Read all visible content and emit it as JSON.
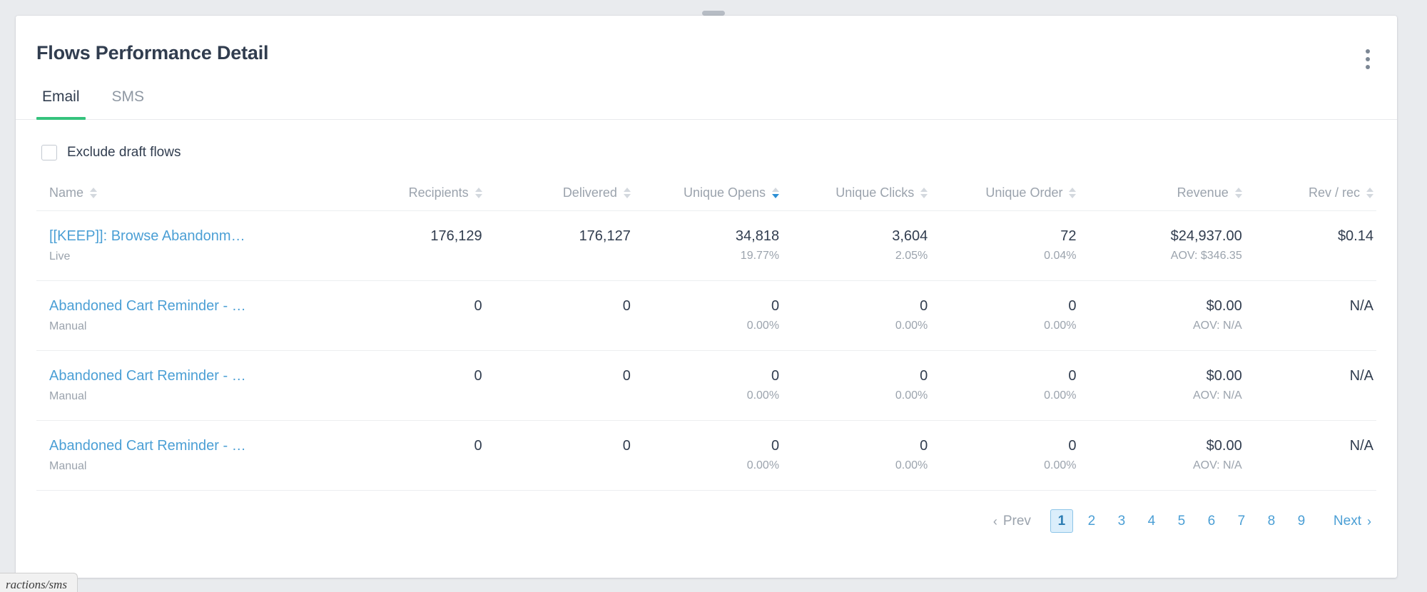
{
  "window": {
    "drag_handle": "drag-handle"
  },
  "header": {
    "title": "Flows Performance Detail",
    "menu_icon": "kebab-menu-icon"
  },
  "tabs": [
    {
      "label": "Email",
      "active": true
    },
    {
      "label": "SMS",
      "active": false
    }
  ],
  "filters": {
    "exclude_draft_flows": {
      "label": "Exclude draft flows",
      "checked": false
    }
  },
  "table": {
    "columns": [
      {
        "key": "name",
        "label": "Name",
        "align": "left",
        "sort": "none"
      },
      {
        "key": "recipients",
        "label": "Recipients",
        "align": "right",
        "sort": "none"
      },
      {
        "key": "delivered",
        "label": "Delivered",
        "align": "right",
        "sort": "none"
      },
      {
        "key": "unique_opens",
        "label": "Unique Opens",
        "align": "right",
        "sort": "desc"
      },
      {
        "key": "unique_clicks",
        "label": "Unique Clicks",
        "align": "right",
        "sort": "none"
      },
      {
        "key": "unique_order",
        "label": "Unique Order",
        "align": "right",
        "sort": "none"
      },
      {
        "key": "revenue",
        "label": "Revenue",
        "align": "right",
        "sort": "none"
      },
      {
        "key": "rev_rec",
        "label": "Rev / rec",
        "align": "right",
        "sort": "none"
      }
    ],
    "rows": [
      {
        "name": "[[KEEP]]: Browse Abandonm…",
        "status": "Live",
        "recipients": "176,129",
        "delivered": "176,127",
        "unique_opens": "34,818",
        "unique_opens_pct": "19.77%",
        "unique_clicks": "3,604",
        "unique_clicks_pct": "2.05%",
        "unique_order": "72",
        "unique_order_pct": "0.04%",
        "revenue": "$24,937.00",
        "revenue_aov": "AOV: $346.35",
        "rev_rec": "$0.14"
      },
      {
        "name": "Abandoned Cart Reminder - …",
        "status": "Manual",
        "recipients": "0",
        "delivered": "0",
        "unique_opens": "0",
        "unique_opens_pct": "0.00%",
        "unique_clicks": "0",
        "unique_clicks_pct": "0.00%",
        "unique_order": "0",
        "unique_order_pct": "0.00%",
        "revenue": "$0.00",
        "revenue_aov": "AOV: N/A",
        "rev_rec": "N/A"
      },
      {
        "name": "Abandoned Cart Reminder - …",
        "status": "Manual",
        "recipients": "0",
        "delivered": "0",
        "unique_opens": "0",
        "unique_opens_pct": "0.00%",
        "unique_clicks": "0",
        "unique_clicks_pct": "0.00%",
        "unique_order": "0",
        "unique_order_pct": "0.00%",
        "revenue": "$0.00",
        "revenue_aov": "AOV: N/A",
        "rev_rec": "N/A"
      },
      {
        "name": "Abandoned Cart Reminder - …",
        "status": "Manual",
        "recipients": "0",
        "delivered": "0",
        "unique_opens": "0",
        "unique_opens_pct": "0.00%",
        "unique_clicks": "0",
        "unique_clicks_pct": "0.00%",
        "unique_order": "0",
        "unique_order_pct": "0.00%",
        "revenue": "$0.00",
        "revenue_aov": "AOV: N/A",
        "rev_rec": "N/A"
      }
    ]
  },
  "pagination": {
    "prev_label": "Prev",
    "next_label": "Next",
    "prev_chevron": "chevron-left-icon",
    "next_chevron": "chevron-right-icon",
    "pages": [
      "1",
      "2",
      "3",
      "4",
      "5",
      "6",
      "7",
      "8",
      "9"
    ],
    "active_page": "1"
  },
  "status_tip": {
    "text": "ractions/sms"
  },
  "colors": {
    "accent_green": "#35c37d",
    "link_blue": "#4b9fd5",
    "sort_active_blue": "#2d8fd5",
    "text_dark": "#313d4f",
    "text_muted": "#9ba3ad",
    "page_bg": "#e9ebee"
  }
}
